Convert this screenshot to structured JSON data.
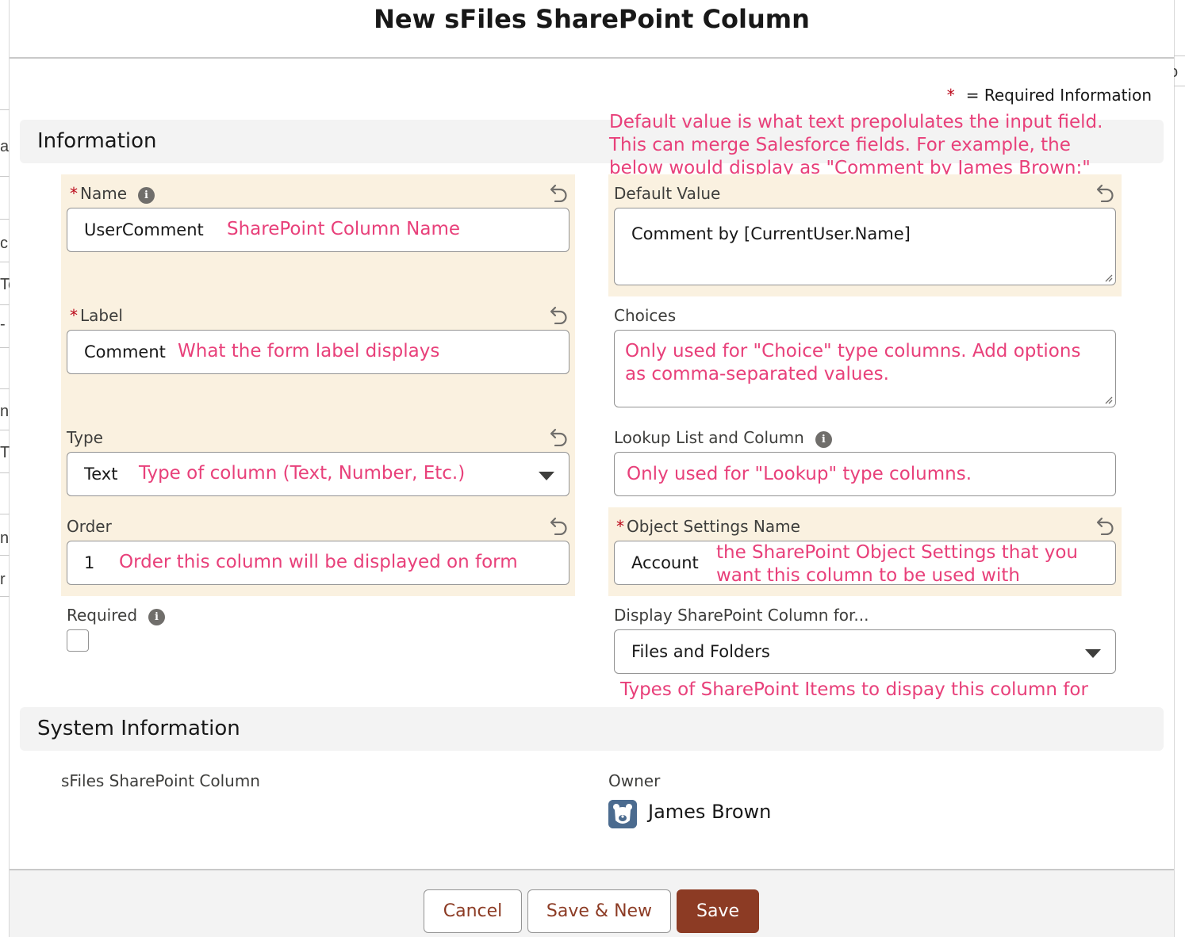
{
  "modal": {
    "title": "New sFiles SharePoint Column",
    "required_legend_star": "*",
    "required_legend_text": "= Required Information"
  },
  "background": {
    "left_fragments": [
      "a",
      "c",
      "Te",
      "-",
      "n",
      "T",
      "n",
      "r"
    ],
    "right_fragments": [
      "o"
    ]
  },
  "sections": {
    "information": "Information",
    "system_information": "System Information"
  },
  "annotations": {
    "default_value_line1": "Default value is what text prepolulates the input field.",
    "default_value_line2": "This can merge Salesforce fields. For example, the",
    "default_value_line3": "below would display as \"Comment by James Brown:\"",
    "name": "SharePoint Column Name",
    "label": "What the form label displays",
    "type": "Type of column (Text, Number, Etc.)",
    "order": "Order this column will be displayed on form",
    "choices_line1": "Only used for \"Choice\" type columns. Add options",
    "choices_line2": "as comma-separated values.",
    "lookup": "Only used for \"Lookup\" type columns.",
    "object_settings_line1": "the SharePoint Object Settings that you",
    "object_settings_line2": "want this column to be used with",
    "display_for": "Types of SharePoint Items to dispay this column for"
  },
  "fields": {
    "name": {
      "label": "Name",
      "required": "*",
      "value": "UserComment"
    },
    "label": {
      "label": "Label",
      "required": "*",
      "value": "Comment"
    },
    "type": {
      "label": "Type",
      "value": "Text"
    },
    "order": {
      "label": "Order",
      "value": "1"
    },
    "required": {
      "label": "Required",
      "checked": false
    },
    "default_value": {
      "label": "Default Value",
      "value": "Comment by [CurrentUser.Name]"
    },
    "choices": {
      "label": "Choices",
      "value": ""
    },
    "lookup": {
      "label": "Lookup List and Column",
      "value": ""
    },
    "object_settings_name": {
      "label": "Object Settings Name",
      "required": "*",
      "value": "Account"
    },
    "display_for": {
      "label": "Display SharePoint Column for...",
      "value": "Files and Folders"
    }
  },
  "system": {
    "record_label": "sFiles SharePoint Column",
    "owner_label": "Owner",
    "owner_name": "James Brown"
  },
  "footer": {
    "cancel_label": "Cancel",
    "save_new_label": "Save & New",
    "save_label": "Save"
  },
  "icons": {
    "info": "info-icon",
    "undo": "undo-icon",
    "caret": "chevron-down-icon",
    "avatar": "bear-avatar-icon"
  },
  "colors": {
    "brand": "#8c3b24",
    "annotation": "#e8407a",
    "highlight": "#faf1e0",
    "required_star": "#ba0517"
  }
}
